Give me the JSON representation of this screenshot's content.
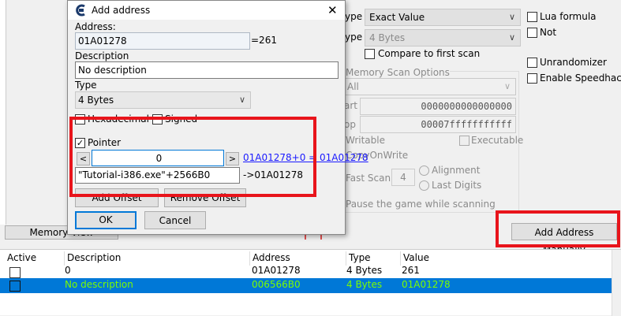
{
  "scan": {
    "type_prefix": "ype",
    "scan_type_value": "Exact Value",
    "type_prefix2": "ype",
    "value_type": "4 Bytes",
    "compare_first": "Compare to first scan",
    "lua_formula": "Lua formula",
    "not_label": "Not",
    "unrandomizer": "Unrandomizer",
    "enable_speedhack": "Enable Speedhack",
    "mem_scan_options": "Memory Scan Options",
    "region_value": "All",
    "start_label": "art",
    "start_value": "0000000000000000",
    "stop_label": "op",
    "stop_value": "00007fffffffffff",
    "writable": "Writable",
    "executable": "Executable",
    "copy_on_write": "CopyOnWrite",
    "fast_scan": "Fast Scan",
    "fast_scan_value": "4",
    "alignment": "Alignment",
    "last_digits": "Last Digits",
    "pause_game": "Pause the game while scanning",
    "add_manually": "Add Address Manually",
    "memory_view": "Memory View"
  },
  "dialog": {
    "title": "Add address",
    "close": "✕",
    "address_label": "Address:",
    "address_value": "01A01278",
    "address_equals": "=261",
    "description_label": "Description",
    "description_value": "No description",
    "type_label": "Type",
    "type_value": "4 Bytes",
    "hexadecimal": "Hexadecimal",
    "signed": "Signed",
    "pointer": "Pointer",
    "offset_value": "0",
    "offset_dec": "<",
    "offset_inc": ">",
    "pointer_result": "01A01278+0 = 01A01278",
    "base_address": "\"Tutorial-i386.exe\"+2566B0",
    "base_result": "->01A01278",
    "add_offset": "Add Offset",
    "remove_offset": "Remove Offset",
    "ok": "OK",
    "cancel": "Cancel"
  },
  "table": {
    "headers": [
      "Active",
      "Description",
      "Address",
      "Type",
      "Value"
    ],
    "rows": [
      {
        "description": "0",
        "address": "01A01278",
        "type": "4 Bytes",
        "value": "261"
      },
      {
        "description": "No description",
        "address": "006566B0",
        "type": "4 Bytes",
        "value": "01A01278"
      }
    ]
  },
  "colors": {
    "highlight_row": "#0078d7",
    "selected_text": "#7cfc00",
    "annotation_red": "#e8141b"
  }
}
